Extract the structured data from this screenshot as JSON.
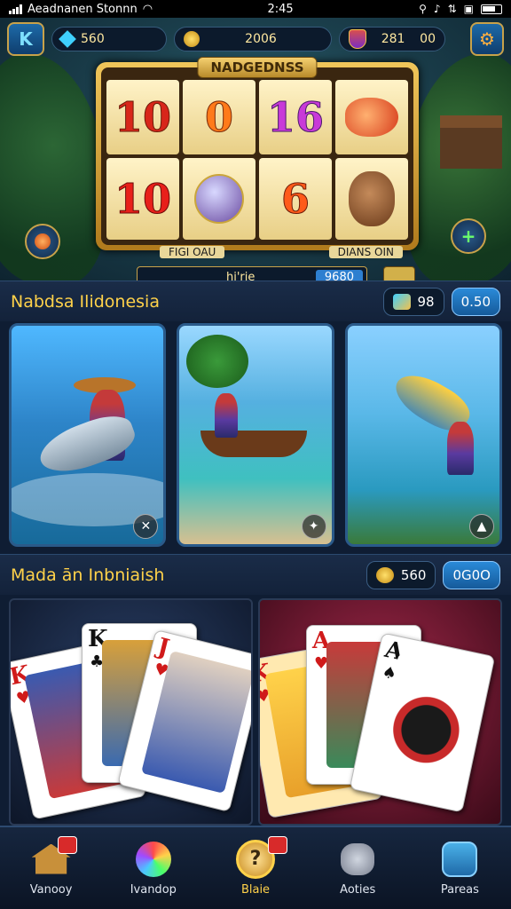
{
  "status_bar": {
    "carrier": "Aeadnanen Stonnn",
    "time": "2:45"
  },
  "hud": {
    "profile_initial": "K",
    "gems": "560",
    "coins": "2006",
    "score_left": "281",
    "score_right": "00"
  },
  "slot": {
    "title": "NADGEDNSS",
    "symbols": [
      "10",
      "0",
      "16",
      "",
      "10",
      "",
      "6",
      ""
    ],
    "label_left": "FIGI OAU",
    "label_right": "DIANS OIN",
    "spin_text": "hi'rie",
    "spin_value": "9680"
  },
  "section_fishing": {
    "title": "Nabdsa Ilidonesia",
    "chip_value": "98",
    "chip_blue": "0.50"
  },
  "section_cards": {
    "title": "Mada ān Inbniaish",
    "chip_value": "560",
    "chip_blue": "0G0O"
  },
  "cards": {
    "ranks": [
      "K",
      "K",
      "J",
      "K",
      "A",
      "A"
    ]
  },
  "bottom_nav": [
    {
      "label": "Vanooy",
      "icon": "home-icon"
    },
    {
      "label": "Ivandop",
      "icon": "random-icon"
    },
    {
      "label": "Blaie",
      "icon": "bonus-icon"
    },
    {
      "label": "Aoties",
      "icon": "action-icon"
    },
    {
      "label": "Pareas",
      "icon": "pages-icon"
    }
  ]
}
